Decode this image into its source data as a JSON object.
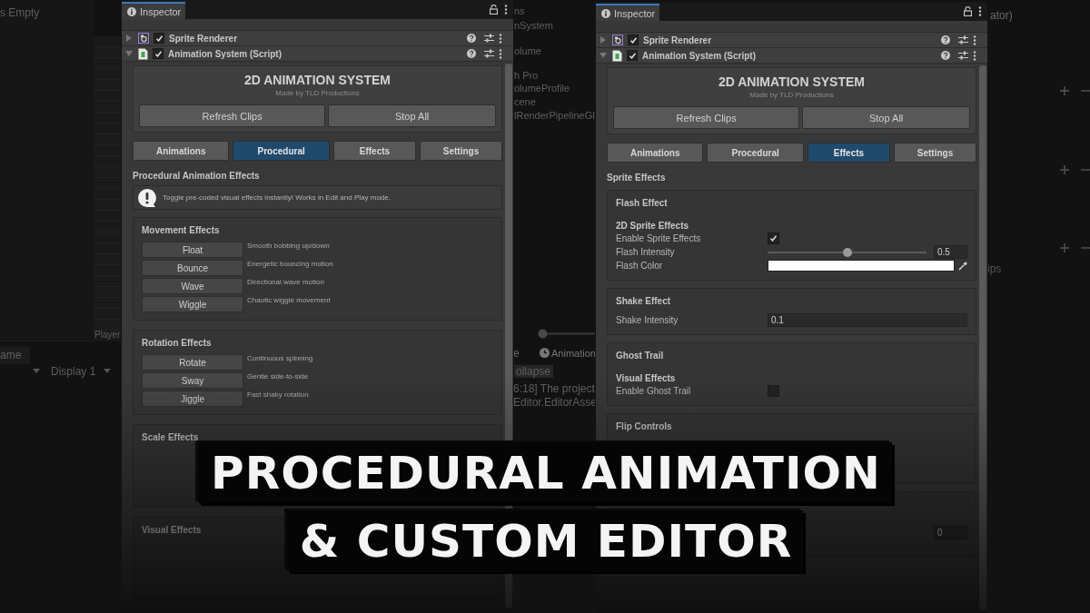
{
  "editor_background": {
    "hierarchy_title": "s Empty",
    "scene_label": "Player",
    "game_tab": "ame",
    "display_dropdown": "Display 1",
    "project_items": [
      "ns",
      "nSystem",
      "olume",
      "h Pro",
      "olumeProfile",
      "cene",
      "lRenderPipelineGl"
    ],
    "bottom_tabs": [
      "e",
      "Animation"
    ],
    "console_button": "ollapse",
    "console_lines": [
      "6:18] The project",
      "Editor.EditorAsse"
    ],
    "right_fragments": [
      "ator)",
      "ips"
    ],
    "zoom_slider": {
      "level": 0
    }
  },
  "panels": [
    {
      "tab": "Inspector",
      "components": [
        {
          "name": "Sprite Renderer",
          "enabled": true,
          "expanded": false,
          "kind": "sprite"
        },
        {
          "name": "Animation System (Script)",
          "enabled": true,
          "expanded": true,
          "kind": "script"
        }
      ],
      "header": {
        "title": "2D ANIMATION SYSTEM",
        "subtitle": "Made by TLD Productions",
        "buttons": [
          "Refresh Clips",
          "Stop All"
        ]
      },
      "tabs": [
        {
          "label": "Animations",
          "selected": false
        },
        {
          "label": "Procedural",
          "selected": true
        },
        {
          "label": "Effects",
          "selected": false
        },
        {
          "label": "Settings",
          "selected": false
        }
      ],
      "content": {
        "kind": "procedural",
        "title": "Procedural Animation Effects",
        "info": "Toggle pre-coded visual effects instantly! Works in Edit and Play mode.",
        "groups": [
          {
            "title": "Movement Effects",
            "effects": [
              {
                "label": "Float",
                "description": "Smooth bobbing up/down"
              },
              {
                "label": "Bounce",
                "description": "Energetic bouncing motion"
              },
              {
                "label": "Wave",
                "description": "Directional wave motion"
              },
              {
                "label": "Wiggle",
                "description": "Chaotic wiggle movement"
              }
            ]
          },
          {
            "title": "Rotation Effects",
            "effects": [
              {
                "label": "Rotate",
                "description": "Continuous spinning"
              },
              {
                "label": "Sway",
                "description": "Gentle side-to-side"
              },
              {
                "label": "Jiggle",
                "description": "Fast shaky rotation"
              }
            ]
          },
          {
            "title": "Scale Effects"
          },
          {
            "title": "Visual Effects"
          }
        ]
      }
    },
    {
      "tab": "Inspector",
      "components": [
        {
          "name": "Sprite Renderer",
          "enabled": true,
          "expanded": false,
          "kind": "sprite"
        },
        {
          "name": "Animation System (Script)",
          "enabled": true,
          "expanded": true,
          "kind": "script"
        }
      ],
      "header": {
        "title": "2D ANIMATION SYSTEM",
        "subtitle": "Made by TLD Productions",
        "buttons": [
          "Refresh Clips",
          "Stop All"
        ]
      },
      "tabs": [
        {
          "label": "Animations",
          "selected": false
        },
        {
          "label": "Procedural",
          "selected": false
        },
        {
          "label": "Effects",
          "selected": true
        },
        {
          "label": "Settings",
          "selected": false
        }
      ],
      "content": {
        "kind": "effects",
        "title": "Sprite Effects",
        "sections": [
          {
            "title": "Flash Effect",
            "subheading": "2D Sprite Effects",
            "fields": [
              {
                "kind": "checkbox",
                "label": "Enable Sprite Effects",
                "checked": true
              },
              {
                "kind": "slider",
                "label": "Flash Intensity",
                "level": 0.5,
                "value": "0.5"
              },
              {
                "kind": "color",
                "label": "Flash Color",
                "color": "#ffffff"
              }
            ]
          },
          {
            "title": "Shake Effect",
            "fields": [
              {
                "kind": "number",
                "label": "Shake Intensity",
                "value": "0.1"
              }
            ]
          },
          {
            "title": "Ghost Trail",
            "subheading": "Visual Effects",
            "fields": [
              {
                "kind": "checkbox",
                "label": "Enable Ghost Trail",
                "checked": false
              }
            ]
          },
          {
            "title": "Flip Controls"
          },
          {
            "fields": [
              {
                "kind": "value_box",
                "value": "0"
              }
            ]
          }
        ]
      }
    }
  ],
  "title_overlay": {
    "lines": [
      "PROCEDURAL ANIMATION",
      "& CUSTOM EDITOR"
    ]
  }
}
